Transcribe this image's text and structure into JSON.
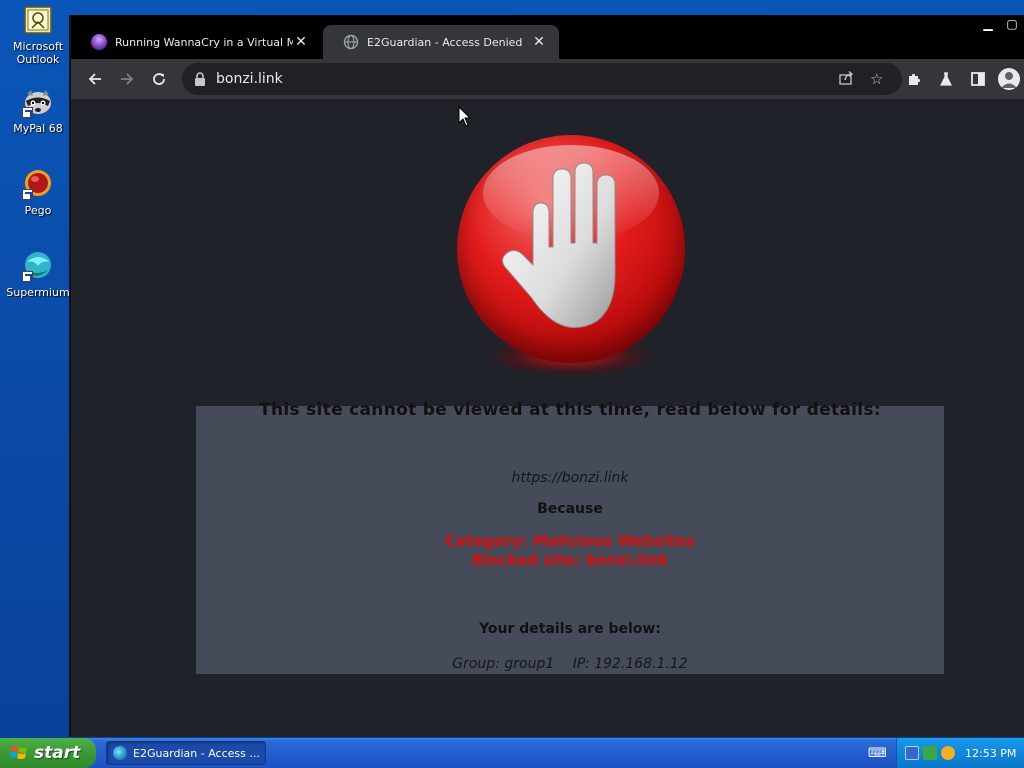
{
  "desktop": {
    "icons": [
      {
        "label": "Microsoft Outlook",
        "icon": "outlook-icon"
      },
      {
        "label": "MyPal 68",
        "icon": "raccoon-icon"
      },
      {
        "label": "Pego",
        "icon": "pego-icon"
      },
      {
        "label": "Supermium",
        "icon": "supermium-icon"
      }
    ]
  },
  "browser": {
    "tabs": [
      {
        "title": "Running WannaCry in a Virtual Mach",
        "icon": "bonzi-favicon",
        "active": false
      },
      {
        "title": "E2Guardian - Access Denied",
        "icon": "globe-icon",
        "active": true
      }
    ],
    "address": "bonzi.link",
    "window_controls": [
      "minimize",
      "maximize"
    ]
  },
  "page": {
    "headline": "This site cannot be viewed at this time, read below for details:",
    "url": "https://bonzi.link",
    "because": "Because",
    "category": "Category: Malicious Websites",
    "blocked_site": "Blocked site: bonzi.link",
    "details_heading": "Your details are below:",
    "group": "Group: group1",
    "ip": "IP: 192.168.1.12"
  },
  "taskbar": {
    "start_label": "start",
    "task_item": "E2Guardian - Access ...",
    "clock": "12:53 PM"
  },
  "colors": {
    "desktop_blue": "#0a56b8",
    "stop_red": "#e31b1b",
    "blocked_text": "#d80e0e",
    "panel": "#464b5a"
  }
}
